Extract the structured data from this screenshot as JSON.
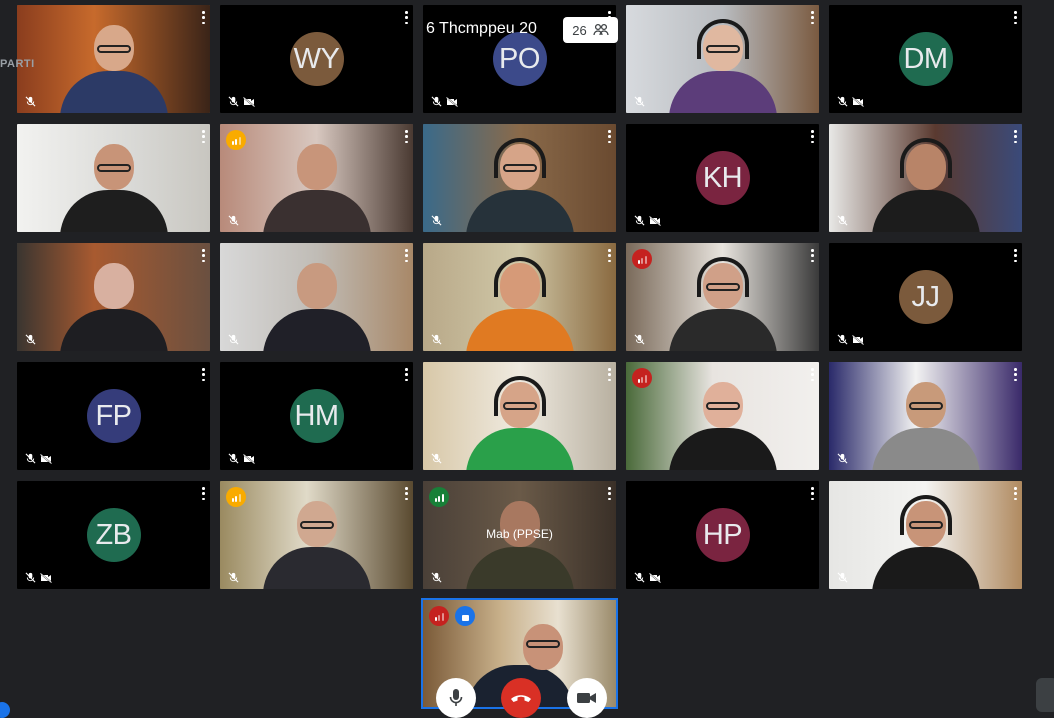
{
  "meeting": {
    "overlay_title": "6 Thcmppeu 20",
    "participant_count": "26",
    "partial_label": "PARTI"
  },
  "colors": {
    "background": "#202124",
    "tile_black": "#000000",
    "self_border": "#1a73e8",
    "end_call": "#d93025",
    "signal_good": "#188038",
    "signal_weak": "#f9ab00",
    "signal_bad": "#c5221f"
  },
  "tiles": [
    {
      "id": "r1c1",
      "type": "video",
      "muted": true,
      "video_off": false,
      "signal": null
    },
    {
      "id": "r1c2",
      "type": "avatar",
      "initials": "WY",
      "color": "#7b5a3c",
      "muted": true,
      "video_off": true
    },
    {
      "id": "r1c3",
      "type": "avatar",
      "initials": "PO",
      "color": "#3c4a8a",
      "muted": true,
      "video_off": true
    },
    {
      "id": "r1c4",
      "type": "video",
      "muted": true,
      "video_off": false,
      "signal": null
    },
    {
      "id": "r1c5",
      "type": "avatar",
      "initials": "DM",
      "color": "#1f6b50",
      "muted": true,
      "video_off": true
    },
    {
      "id": "r2c1",
      "type": "video",
      "muted": false,
      "video_off": false,
      "signal": null
    },
    {
      "id": "r2c2",
      "type": "video",
      "muted": true,
      "video_off": false,
      "signal": "weak"
    },
    {
      "id": "r2c3",
      "type": "video",
      "muted": true,
      "video_off": false,
      "signal": null
    },
    {
      "id": "r2c4",
      "type": "avatar",
      "initials": "KH",
      "color": "#7a2440",
      "muted": true,
      "video_off": true
    },
    {
      "id": "r2c5",
      "type": "video",
      "muted": true,
      "video_off": false,
      "signal": null
    },
    {
      "id": "r3c1",
      "type": "video",
      "muted": true,
      "video_off": false,
      "signal": null
    },
    {
      "id": "r3c2",
      "type": "video",
      "muted": true,
      "video_off": false,
      "signal": null
    },
    {
      "id": "r3c3",
      "type": "video",
      "muted": true,
      "video_off": false,
      "signal": null
    },
    {
      "id": "r3c4",
      "type": "video",
      "muted": true,
      "video_off": false,
      "signal": "bad"
    },
    {
      "id": "r3c5",
      "type": "avatar",
      "initials": "JJ",
      "color": "#7b5a3c",
      "muted": true,
      "video_off": true
    },
    {
      "id": "r4c1",
      "type": "avatar",
      "initials": "FP",
      "color": "#353c7a",
      "muted": true,
      "video_off": true
    },
    {
      "id": "r4c2",
      "type": "avatar",
      "initials": "HM",
      "color": "#1f6b50",
      "muted": true,
      "video_off": true
    },
    {
      "id": "r4c3",
      "type": "video",
      "muted": true,
      "video_off": false,
      "signal": null
    },
    {
      "id": "r4c4",
      "type": "video",
      "muted": false,
      "video_off": false,
      "signal": "bad"
    },
    {
      "id": "r4c5",
      "type": "video",
      "muted": true,
      "video_off": false,
      "signal": null
    },
    {
      "id": "r5c1",
      "type": "avatar",
      "initials": "ZB",
      "color": "#1f6b50",
      "muted": true,
      "video_off": true
    },
    {
      "id": "r5c2",
      "type": "video",
      "muted": true,
      "video_off": false,
      "signal": "weak"
    },
    {
      "id": "r5c3",
      "type": "video",
      "muted": true,
      "video_off": false,
      "signal": "good",
      "name": "Mab (PPSE)"
    },
    {
      "id": "r5c4",
      "type": "avatar",
      "initials": "HP",
      "color": "#7a2440",
      "muted": true,
      "video_off": true
    },
    {
      "id": "r5c5",
      "type": "video",
      "muted": true,
      "video_off": false,
      "signal": null
    }
  ],
  "controls": {
    "mic_icon": "microphone-icon",
    "end_icon": "phone-hangup-icon",
    "camera_icon": "camera-icon"
  }
}
